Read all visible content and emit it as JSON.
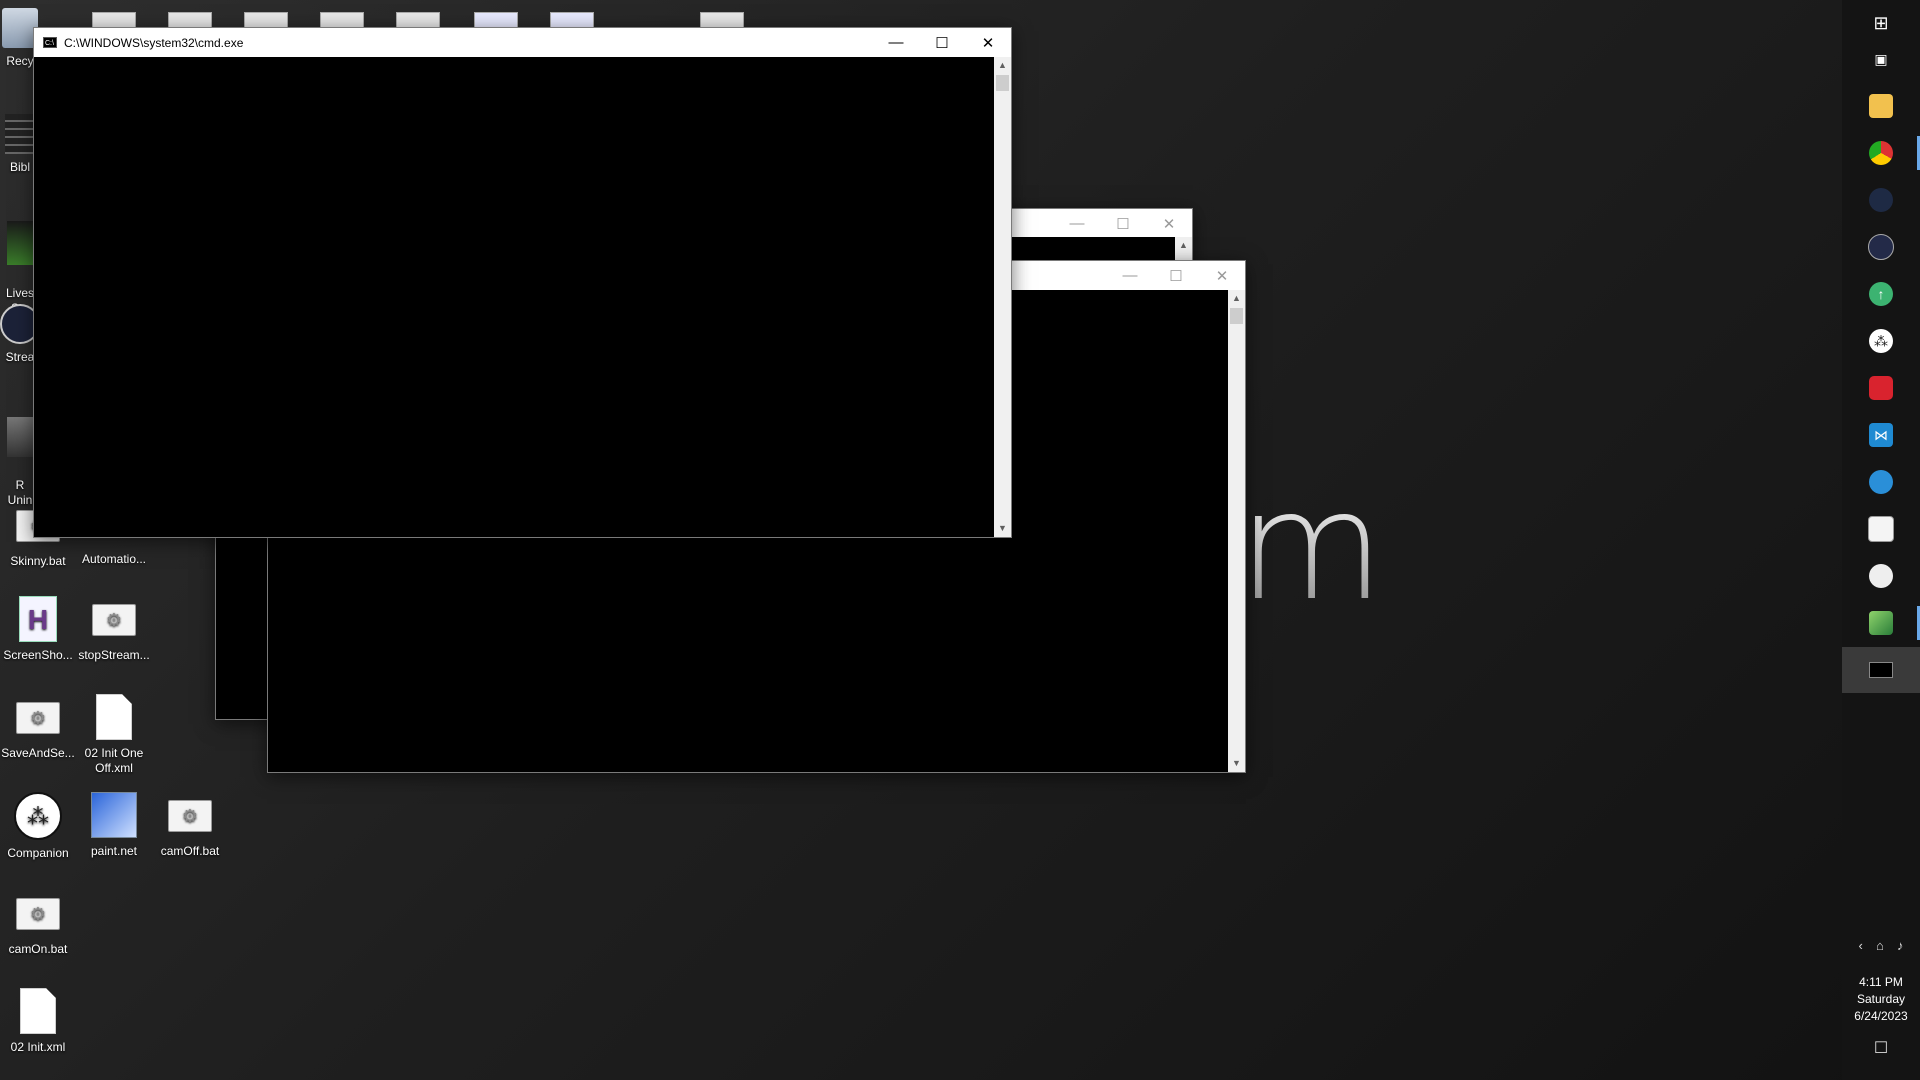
{
  "wallpaper": {
    "text": "m"
  },
  "desktop_icons": {
    "recycle": "Recy",
    "bible": "Bibl",
    "livestream": "Lives\nStu",
    "streamdeck": "Strea",
    "uninstall": "R\nUnin",
    "skinny": "Skinny.bat",
    "automation": "Automatio...",
    "screenshot": "ScreenSho...",
    "stopstream": "stopStream...",
    "saveandse": "SaveAndSe...",
    "init_one_off": "02 Init One Off.xml",
    "companion": "Companion",
    "paintnet": "paint.net",
    "camoff": "camOff.bat",
    "camon": "camOn.bat",
    "init": "02 Init.xml"
  },
  "windows": {
    "front": {
      "title": "C:\\WINDOWS\\system32\\cmd.exe"
    },
    "controls": {
      "minimize": "—",
      "maximize": "☐",
      "close": "✕"
    }
  },
  "taskbar": {
    "items": [
      "start-icon",
      "task-view-icon",
      "file-explorer-icon",
      "chrome-icon",
      "obs-icon",
      "streamdeck-icon",
      "upload-icon",
      "companion-icon",
      "app-red-icon",
      "vscode-icon",
      "app-blue-icon",
      "spreadsheet-icon",
      "clock-app-icon",
      "paintnet-icon",
      "cmd-icon"
    ]
  },
  "tray": {
    "chevron": "‹",
    "time": "4:11 PM",
    "day": "Saturday",
    "date": "6/24/2023"
  }
}
